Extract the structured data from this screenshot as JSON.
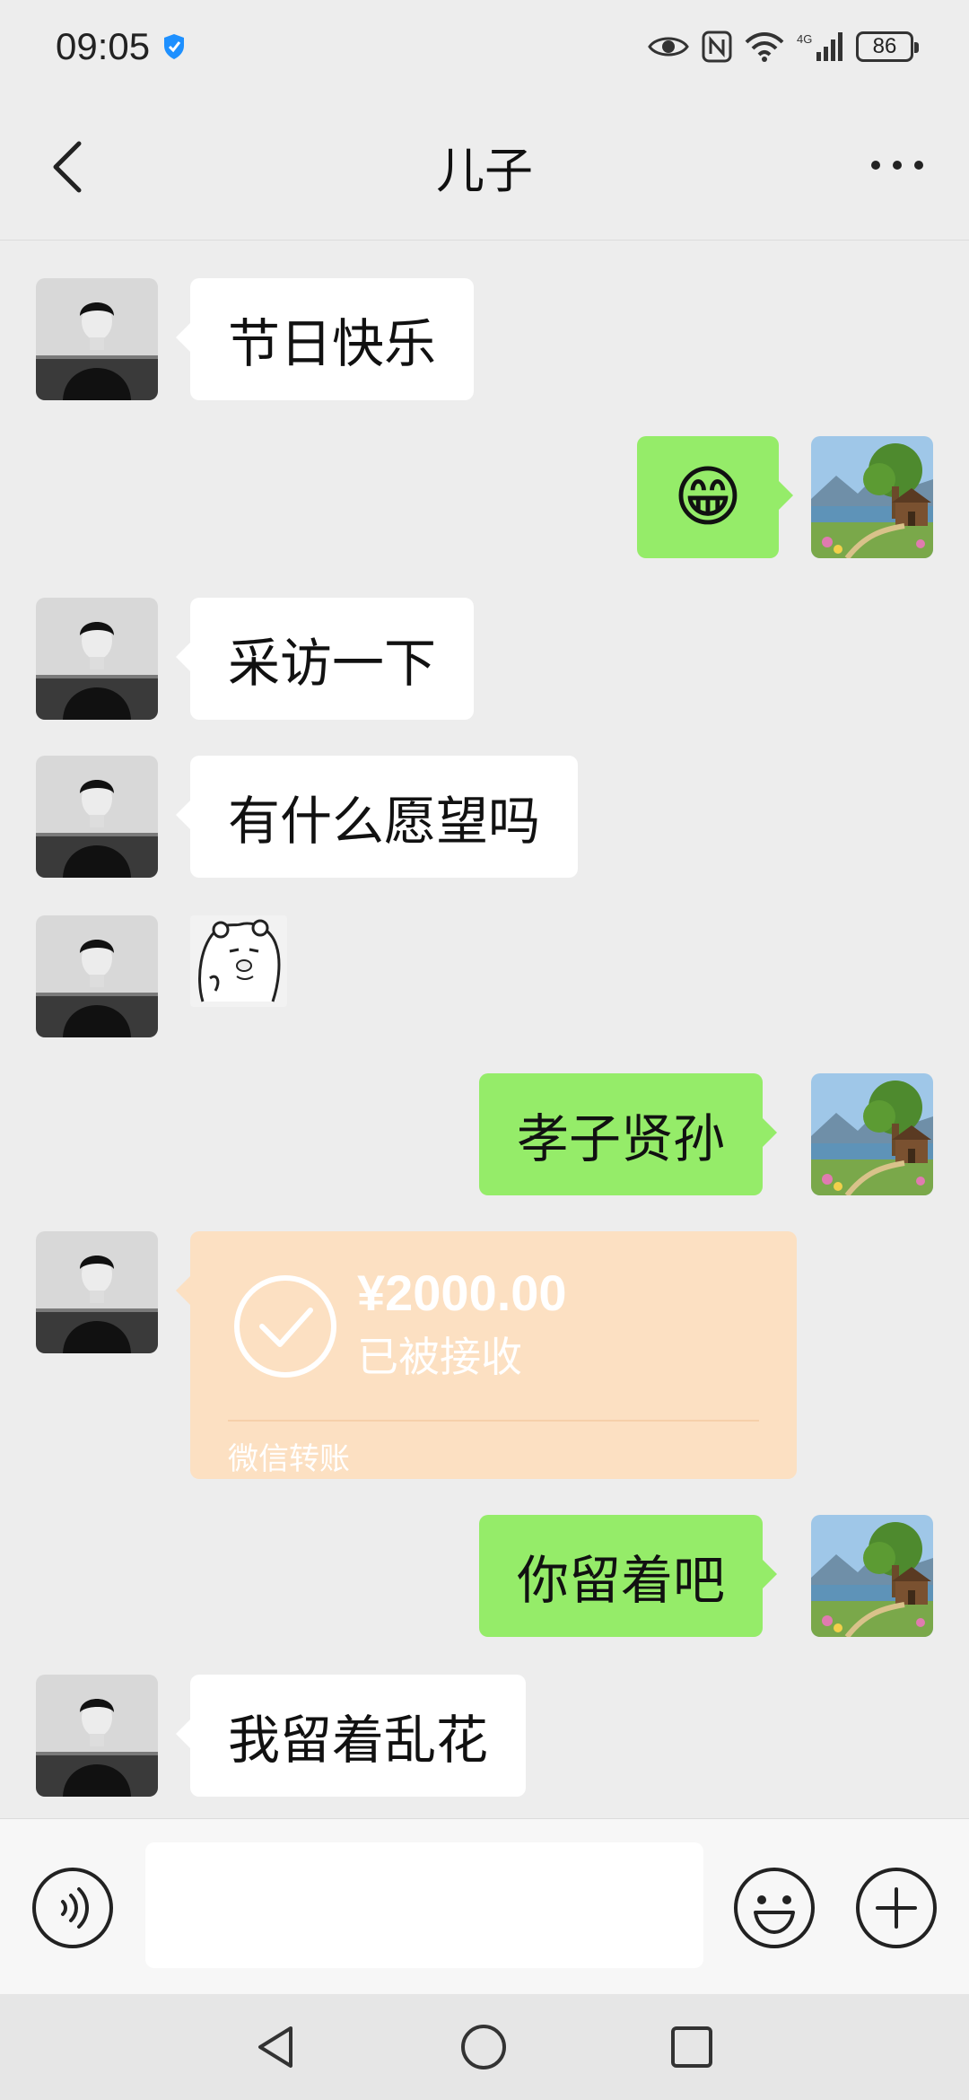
{
  "status_bar": {
    "time": "09:05",
    "battery": "86",
    "network": "4G"
  },
  "header": {
    "title": "儿子"
  },
  "messages": [
    {
      "side": "left",
      "type": "text",
      "text": "节日快乐"
    },
    {
      "side": "right",
      "type": "emoji",
      "emoji": "😁"
    },
    {
      "side": "left",
      "type": "text",
      "text": "采访一下"
    },
    {
      "side": "left",
      "type": "text",
      "text": "有什么愿望吗"
    },
    {
      "side": "left",
      "type": "sticker",
      "sticker": "bear-sticker"
    },
    {
      "side": "right",
      "type": "text",
      "text": "孝子贤孙"
    },
    {
      "side": "left",
      "type": "transfer",
      "amount": "¥2000.00",
      "status": "已被接收",
      "footer": "微信转账"
    },
    {
      "side": "right",
      "type": "text",
      "text": "你留着吧"
    },
    {
      "side": "left",
      "type": "text",
      "text": "我留着乱花"
    }
  ],
  "input_bar": {
    "placeholder": "",
    "value": ""
  },
  "colors": {
    "background": "#ededed",
    "bubble_mine": "#95ec69",
    "bubble_other": "#ffffff",
    "transfer_card": "#fce0c2"
  },
  "icons": {
    "back": "chevron-left-icon",
    "more": "more-dots-icon",
    "voice": "voice-icon",
    "emoji": "emoji-icon",
    "plus": "plus-icon"
  }
}
